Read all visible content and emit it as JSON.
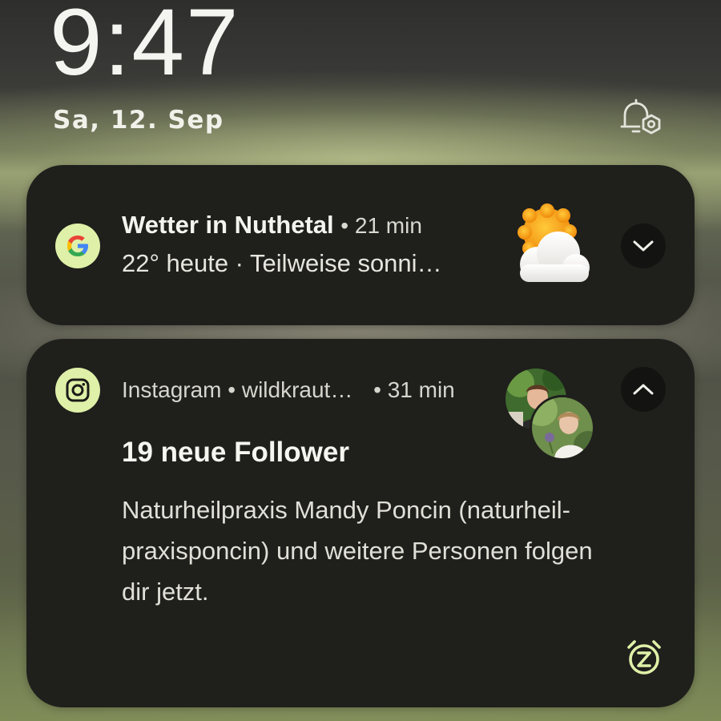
{
  "lockscreen": {
    "time": "9:47",
    "date": "Sa, 12. Sep"
  },
  "notifications": [
    {
      "app": "Google",
      "icon": "google-g-icon",
      "title": "Wetter in Nuthetal",
      "time": "• 21 min",
      "text": "22° heute · Teilweise sonni…",
      "large_icon": "partly-sunny-icon"
    },
    {
      "app": "Instagram",
      "icon": "instagram-icon",
      "header": "Instagram • wildkraut…",
      "time": "• 31 min",
      "title": "19 neue Follower",
      "text": "Naturheilpraxis Mandy Poncin (naturheil-praxisponcin) und weitere Personen folgen dir jetzt.",
      "text_lines": [
        "Naturheilpraxis Mandy Poncin (naturheil-",
        "praxisponcin) und weitere Personen folgen",
        "dir jetzt."
      ]
    }
  ],
  "colors": {
    "card_bg": "#1f1f1c",
    "badge_bg": "#dff0a8",
    "accent": "#dff0a8"
  }
}
